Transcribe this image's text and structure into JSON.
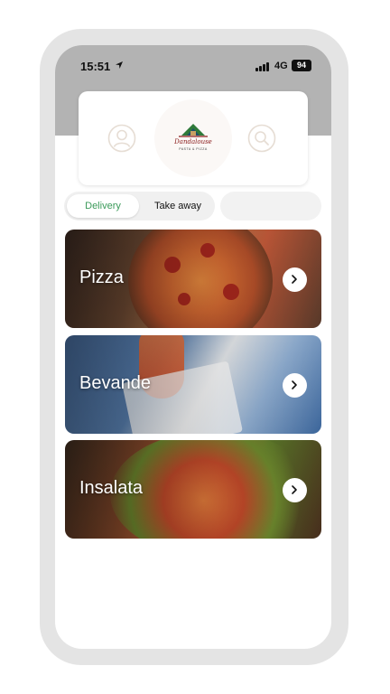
{
  "status_bar": {
    "time": "15:51",
    "network": "4G",
    "battery": "94",
    "icons": [
      "location-arrow-icon",
      "signal-bars-icon",
      "battery-icon"
    ]
  },
  "header": {
    "logo": {
      "name": "Dandalouse",
      "subtitle": "PASTA & PIZZA"
    },
    "icons": [
      "profile-icon",
      "search-icon"
    ]
  },
  "order_mode": {
    "options": [
      "Delivery",
      "Take away"
    ],
    "selected": "Delivery"
  },
  "categories": [
    {
      "label": "Pizza",
      "icon": "chevron-right-icon"
    },
    {
      "label": "Bevande",
      "icon": "chevron-right-icon"
    },
    {
      "label": "Insalata",
      "icon": "chevron-right-icon"
    }
  ],
  "colors": {
    "accent_green": "#3b9a5a",
    "top_band": "#b3b3b3",
    "logo_red": "#8a1a1a"
  }
}
